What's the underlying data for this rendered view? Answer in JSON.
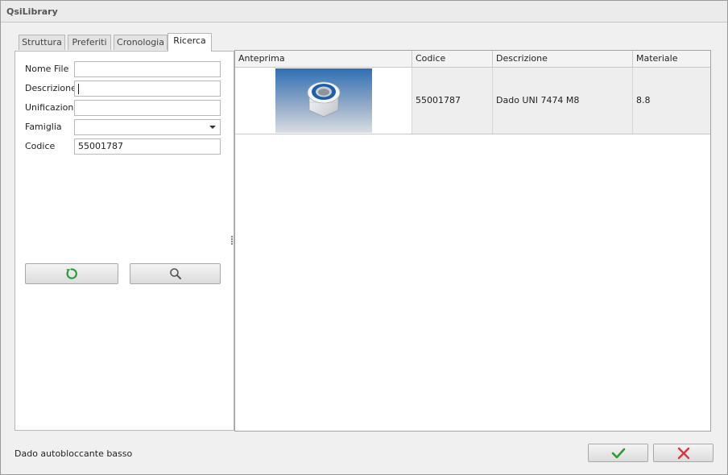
{
  "window": {
    "title": "QsiLibrary"
  },
  "tabs": [
    {
      "label": "Struttura",
      "active": false
    },
    {
      "label": "Preferiti",
      "active": false
    },
    {
      "label": "Cronologia",
      "active": false
    },
    {
      "label": "Ricerca",
      "active": true
    }
  ],
  "form": {
    "nome_file": {
      "label": "Nome File",
      "value": ""
    },
    "descrizione": {
      "label": "Descrizione",
      "value": ""
    },
    "unificazione": {
      "label": "Unificazione",
      "value": ""
    },
    "famiglia": {
      "label": "Famiglia",
      "value": ""
    },
    "codice": {
      "label": "Codice",
      "value": "55001787"
    }
  },
  "buttons": {
    "reset_icon": "refresh-icon",
    "search_icon": "magnifier-icon"
  },
  "grid": {
    "columns": [
      "Anteprima",
      "Codice",
      "Descrizione",
      "Materiale"
    ],
    "rows": [
      {
        "preview_icon": "hex-nut-thumbnail",
        "codice": "55001787",
        "descrizione": "Dado UNI 7474 M8",
        "materiale": "8.8"
      }
    ]
  },
  "status": {
    "text": "Dado autobloccante basso"
  },
  "actions": {
    "ok_icon": "checkmark-icon",
    "cancel_icon": "x-icon"
  },
  "colors": {
    "ok": "#2e9b39",
    "cancel": "#d9363e",
    "accent_blue": "#2f6fb5"
  }
}
